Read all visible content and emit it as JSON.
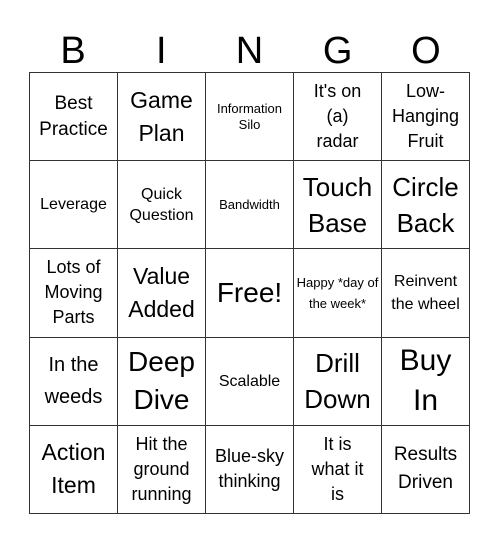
{
  "title_letters": [
    "B",
    "I",
    "N",
    "G",
    "O"
  ],
  "rows": [
    [
      "Best Practice",
      "Game Plan",
      "Information Silo",
      "It's on (a) radar",
      "Low-Hanging Fruit"
    ],
    [
      "Leverage",
      "Quick Question",
      "Bandwidth",
      "Touch Base",
      "Circle Back"
    ],
    [
      "Lots of Moving Parts",
      "Value Added",
      "Free!",
      "Happy *day of the week*",
      "Reinvent the wheel"
    ],
    [
      "In the weeds",
      "Deep Dive",
      "Scalable",
      "Drill Down",
      "Buy In"
    ],
    [
      "Action Item",
      "Hit the ground running",
      "Blue-sky thinking",
      "It is what it is",
      "Results Driven"
    ]
  ]
}
